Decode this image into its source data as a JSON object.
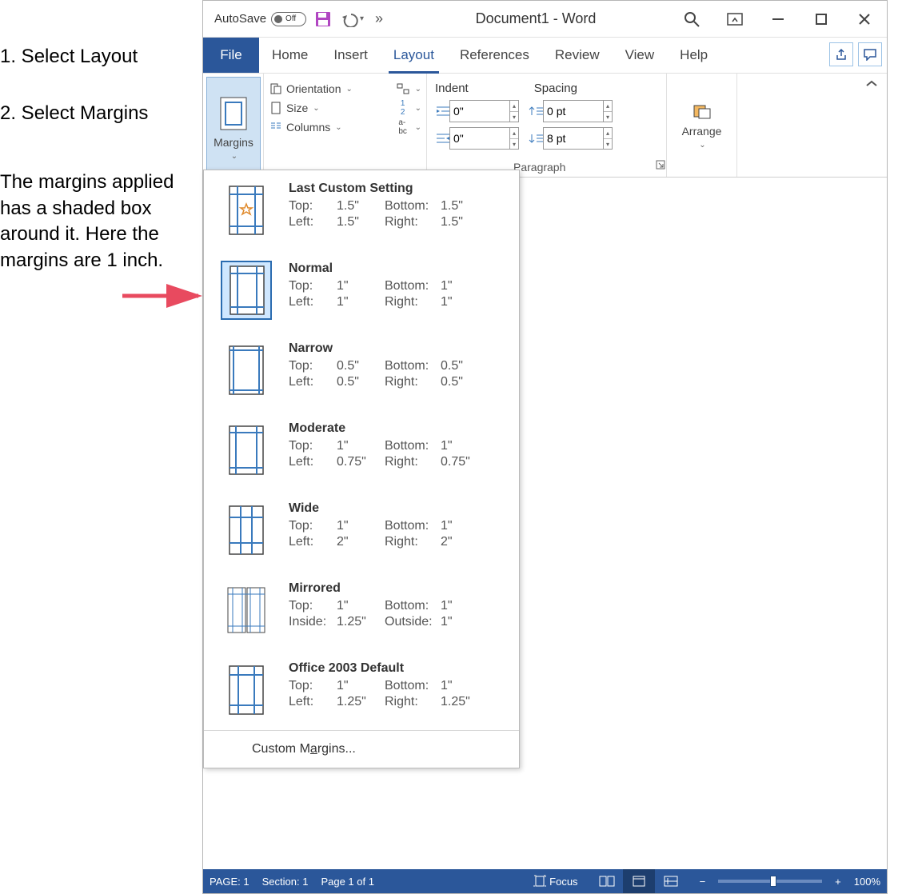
{
  "annotations": {
    "step1": "1. Select Layout",
    "step2": "2. Select Margins",
    "note": "The margins applied has a shaded box around it. Here the margins are 1 inch."
  },
  "title": {
    "autosave_label": "AutoSave",
    "autosave_state": "Off",
    "document_title": "Document1  -  Word",
    "more": "»"
  },
  "tabs": {
    "file": "File",
    "items": [
      "Home",
      "Insert",
      "Layout",
      "References",
      "Review",
      "View",
      "Help"
    ],
    "active": "Layout"
  },
  "ribbon": {
    "margins_label": "Margins",
    "orientation": "Orientation",
    "size": "Size",
    "columns": "Columns",
    "indent_label": "Indent",
    "spacing_label": "Spacing",
    "indent_left": "0\"",
    "indent_right": "0\"",
    "space_before": "0 pt",
    "space_after": "8 pt",
    "arrange": "Arrange",
    "paragraph_group": "Paragraph"
  },
  "margins_menu": {
    "selected_index": 1,
    "items": [
      {
        "title": "Last Custom Setting",
        "rows": [
          [
            "Top:",
            "1.5\"",
            "Bottom:",
            "1.5\""
          ],
          [
            "Left:",
            "1.5\"",
            "Right:",
            "1.5\""
          ]
        ]
      },
      {
        "title": "Normal",
        "rows": [
          [
            "Top:",
            "1\"",
            "Bottom:",
            "1\""
          ],
          [
            "Left:",
            "1\"",
            "Right:",
            "1\""
          ]
        ]
      },
      {
        "title": "Narrow",
        "rows": [
          [
            "Top:",
            "0.5\"",
            "Bottom:",
            "0.5\""
          ],
          [
            "Left:",
            "0.5\"",
            "Right:",
            "0.5\""
          ]
        ]
      },
      {
        "title": "Moderate",
        "rows": [
          [
            "Top:",
            "1\"",
            "Bottom:",
            "1\""
          ],
          [
            "Left:",
            "0.75\"",
            "Right:",
            "0.75\""
          ]
        ]
      },
      {
        "title": "Wide",
        "rows": [
          [
            "Top:",
            "1\"",
            "Bottom:",
            "1\""
          ],
          [
            "Left:",
            "2\"",
            "Right:",
            "2\""
          ]
        ]
      },
      {
        "title": "Mirrored",
        "rows": [
          [
            "Top:",
            "1\"",
            "Bottom:",
            "1\""
          ],
          [
            "Inside:",
            "1.25\"",
            "Outside:",
            "1\""
          ]
        ]
      },
      {
        "title": "Office 2003 Default",
        "rows": [
          [
            "Top:",
            "1\"",
            "Bottom:",
            "1\""
          ],
          [
            "Left:",
            "1.25\"",
            "Right:",
            "1.25\""
          ]
        ]
      }
    ],
    "custom": "Custom Margins..."
  },
  "status": {
    "page": "PAGE: 1",
    "section": "Section: 1",
    "pages": "Page 1 of 1",
    "focus": "Focus",
    "zoom": "100%"
  }
}
